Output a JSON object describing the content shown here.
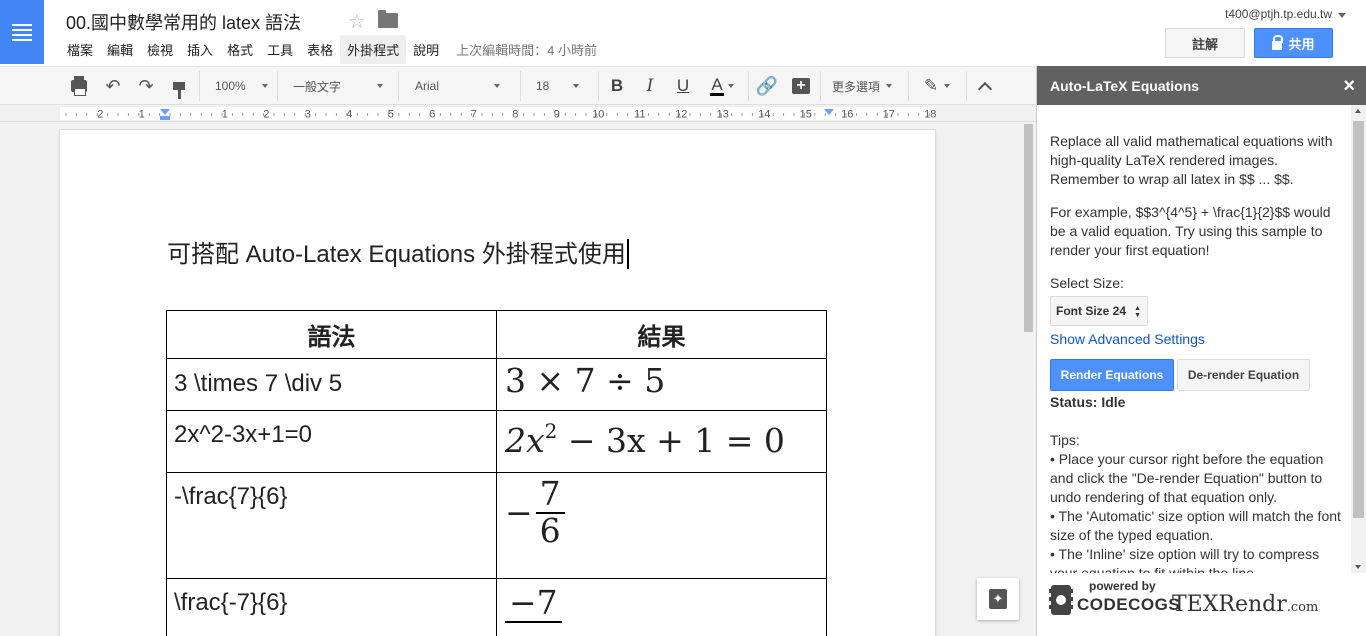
{
  "app": {
    "doc_title": "00.國中數學常用的 latex 語法",
    "menu": [
      "檔案",
      "編輯",
      "檢視",
      "插入",
      "格式",
      "工具",
      "表格",
      "外掛程式",
      "說明"
    ],
    "active_menu_index": 7,
    "last_edit": "上次編輯時間：4 小時前",
    "user_email": "t400@ptjh.tp.edu.tw",
    "comment_label": "註解",
    "share_label": "共用"
  },
  "toolbar": {
    "zoom": "100%",
    "style": "一般文字",
    "font": "Arial",
    "font_size": "18",
    "bold": "B",
    "italic": "I",
    "underline": "U",
    "text_color_letter": "A",
    "more": "更多選項"
  },
  "ruler": {
    "labels": [
      "2",
      "1",
      "1",
      "2",
      "3",
      "4",
      "5",
      "6",
      "7",
      "8",
      "9",
      "10",
      "11",
      "12",
      "13",
      "14",
      "15",
      "16",
      "17",
      "18"
    ]
  },
  "document": {
    "intro": "可搭配 Auto-Latex Equations 外掛程式使用",
    "table_headers": [
      "語法",
      "結果"
    ],
    "rows": [
      {
        "source": "3 \\times 7 \\div 5",
        "result": "3 × 7 ÷ 5"
      },
      {
        "source": "2x^2-3x+1=0",
        "result_a": "2x",
        "result_sup": "2",
        "result_b": " − 3x + 1 = 0"
      },
      {
        "source": "-\\frac{7}{6}",
        "result_sign": "−",
        "result_num": "7",
        "result_den": "6"
      },
      {
        "source": "\\frac{-7}{6}",
        "result_num": "−7"
      }
    ]
  },
  "sidebar": {
    "title": "Auto-LaTeX Equations",
    "close": "×",
    "intro": "Replace all valid mathematical equations with high-quality LaTeX rendered images. Remember to wrap all latex in $$ ... $$.",
    "example": "For example, $$3^{4^5} + \\frac{1}{2}$$ would be a valid equation. Try using this sample to render your first equation!",
    "select_size_label": "Select Size:",
    "size_value": "Font Size 24",
    "advanced_link": "Show Advanced Settings",
    "render_button": "Render Equations",
    "derender_button": "De-render Equation",
    "status": "Status: Idle",
    "tips_heading": "Tips:",
    "tips": [
      "• Place your cursor right before the equation and click the \"De-render Equation\" button to undo rendering of that equation only.",
      "• The 'Automatic' size option will match the font size of the typed equation.",
      "• The 'Inline' size option will try to compress your equation to fit within the line."
    ],
    "powered_by": "powered by",
    "codecogs": "CODECOGS",
    "texrendr": "TEXRendr",
    "texrendr_suffix": ".com"
  },
  "colors": {
    "doc_blue": "#4285f4",
    "share_blue": "#4d90fe",
    "sidebar_header": "#616161",
    "link": "#1155cc"
  }
}
